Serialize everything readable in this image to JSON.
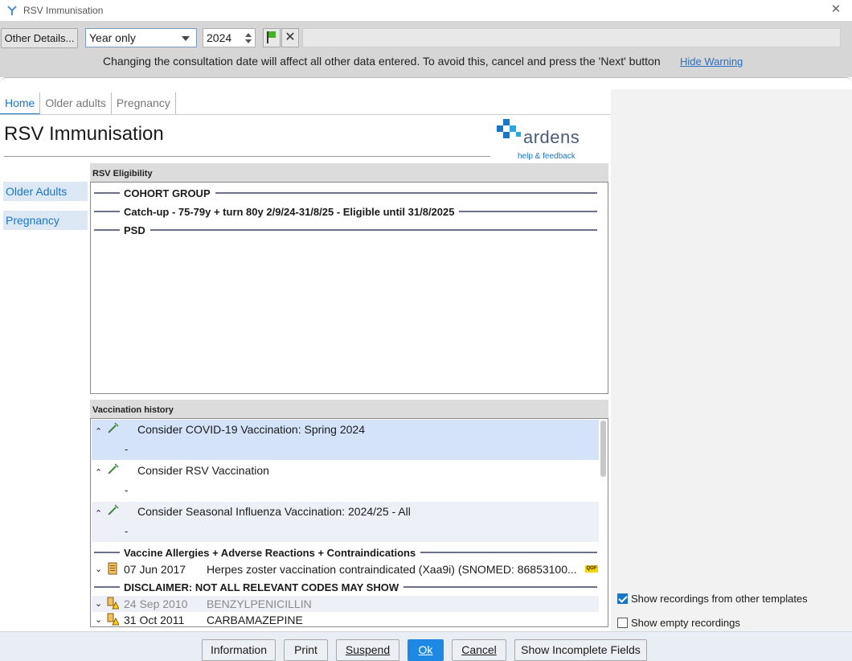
{
  "window": {
    "title": "RSV Immunisation",
    "close_icon": "close-icon"
  },
  "toolbar": {
    "other_details_label": "Other Details...",
    "date_mode": "Year only",
    "year": "2024",
    "flag_icon": "green-flag-icon",
    "cancel_icon": "x-icon",
    "warning_text": "Changing the consultation date will affect all other data entered. To avoid this, cancel and press the 'Next' button",
    "hide_warning_label": "Hide Warning"
  },
  "tabs": [
    {
      "label": "Home",
      "active": true
    },
    {
      "label": "Older adults",
      "active": false
    },
    {
      "label": "Pregnancy",
      "active": false
    }
  ],
  "page": {
    "title": "RSV Immunisation",
    "logo_text": "ardens",
    "logo_subtext": "help & feedback"
  },
  "nav": [
    {
      "label": "Older Adults"
    },
    {
      "label": "Pregnancy"
    }
  ],
  "eligibility": {
    "header": "RSV Eligibility",
    "rows": [
      "COHORT GROUP",
      "Catch-up - 75-79y + turn 80y 2/9/24-31/8/25 - Eligible until 31/8/2025",
      "PSD"
    ]
  },
  "vaccination": {
    "header": "Vaccination history",
    "items": [
      {
        "title": "Consider COVID-19 Vaccination: Spring 2024",
        "value": "-"
      },
      {
        "title": "Consider RSV Vaccination",
        "value": "-"
      },
      {
        "title": "Consider Seasonal Influenza Vaccination: 2024/25 - All",
        "value": "-"
      }
    ],
    "allergy_section": "Vaccine Allergies + Adverse Reactions + Contraindications",
    "records": [
      {
        "date": "07 Jun 2017",
        "text": "Herpes zoster vaccination contraindicated (Xaa9i) (SNOMED: 86853100...",
        "badge": "QOF"
      }
    ],
    "disclaimer": "DISCLAIMER: NOT ALL RELEVANT CODES MAY SHOW",
    "allergies": [
      {
        "date": "24 Sep 2010",
        "text": "BENZYLPENICILLIN",
        "greyed": true
      },
      {
        "date": "31 Oct 2011",
        "text": "CARBAMAZEPINE",
        "greyed": false
      }
    ]
  },
  "options": {
    "show_other_templates": {
      "label": "Show recordings from other templates",
      "checked": true
    },
    "show_empty": {
      "label": "Show empty recordings",
      "checked": false
    }
  },
  "footer": {
    "information": "Information",
    "print": "Print",
    "suspend": "Suspend",
    "ok": "Ok",
    "cancel": "Cancel",
    "incomplete": "Show Incomplete Fields"
  }
}
